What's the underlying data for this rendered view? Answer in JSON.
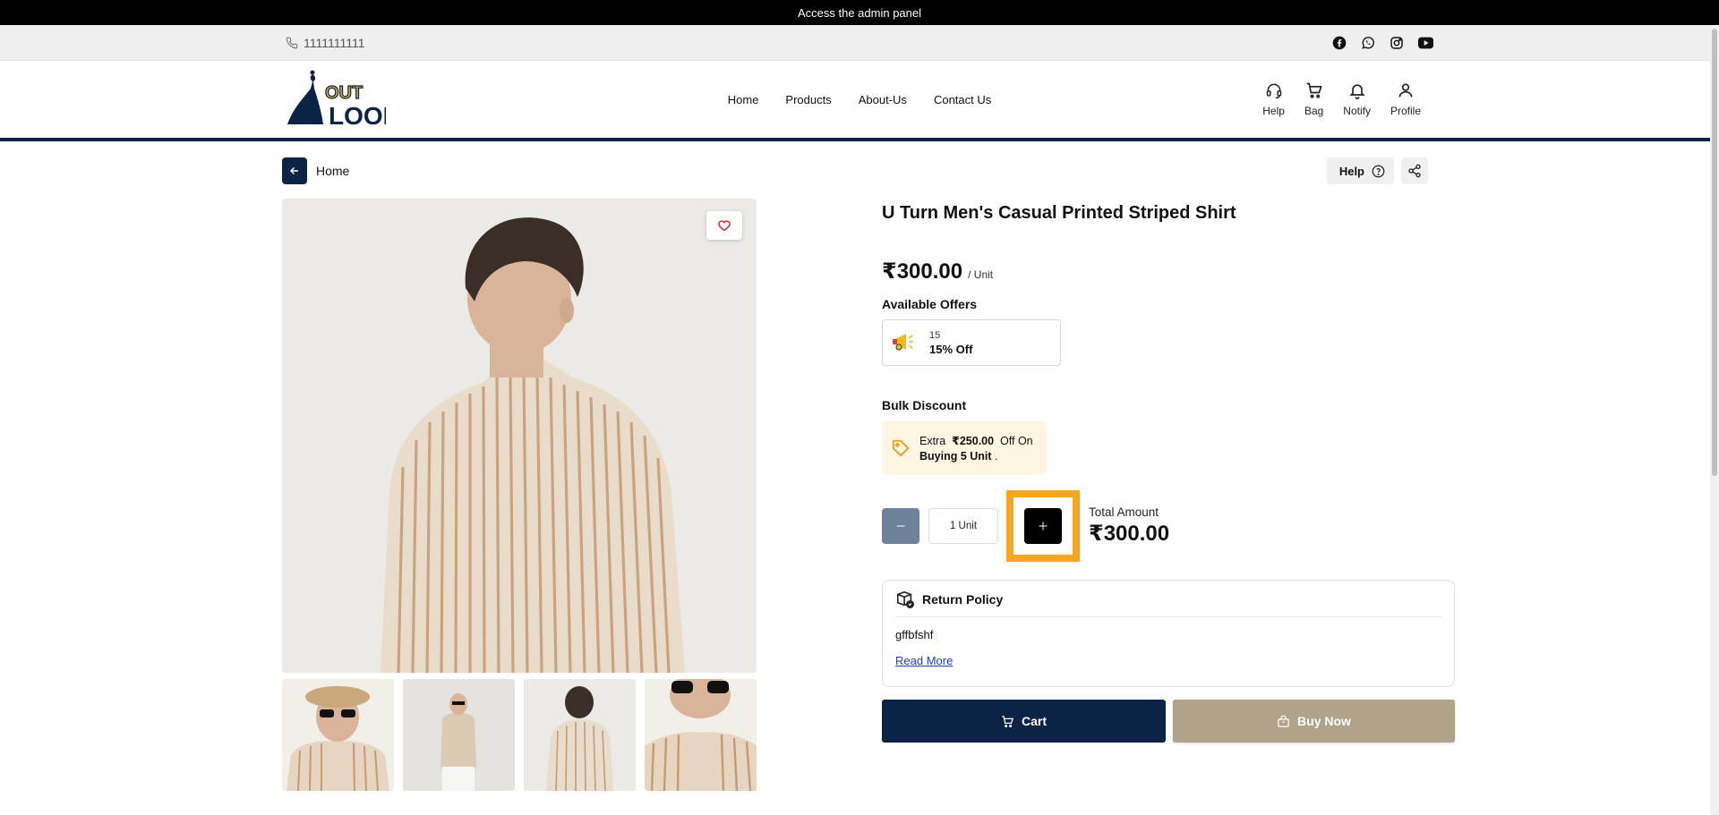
{
  "admin_bar": {
    "text": "Access the admin panel"
  },
  "contact": {
    "phone": "1111111111",
    "socials": [
      "facebook-icon",
      "whatsapp-icon",
      "instagram-icon",
      "youtube-icon"
    ]
  },
  "nav": {
    "links": [
      "Home",
      "Products",
      "About-Us",
      "Contact Us"
    ],
    "icons": [
      {
        "label": "Help",
        "icon": "headset-icon"
      },
      {
        "label": "Bag",
        "icon": "cart-icon"
      },
      {
        "label": "Notify",
        "icon": "bell-icon"
      },
      {
        "label": "Profile",
        "icon": "user-icon"
      }
    ]
  },
  "breadcrumb": {
    "label": "Home"
  },
  "toolbar": {
    "help_label": "Help"
  },
  "product": {
    "title": "U Turn Men's Casual Printed Striped Shirt",
    "price": "₹300.00",
    "unit": "/ Unit",
    "offers_label": "Available Offers",
    "offer": {
      "code": "15",
      "text": "15% Off"
    },
    "bulk_label": "Bulk Discount",
    "bulk": {
      "prefix": "Extra",
      "amount": "₹250.00",
      "suffix": "Off On",
      "condition": "Buying 5 Unit",
      "dot": "."
    },
    "quantity": "1 Unit",
    "total_label": "Total Amount",
    "total": "₹300.00",
    "policy": {
      "title": "Return Policy",
      "body": "gffbfshf",
      "read_more": "Read More"
    },
    "actions": {
      "cart": "Cart",
      "buy": "Buy Now"
    }
  },
  "colors": {
    "navy": "#0b2344",
    "buy": "#b1a28a",
    "highlight": "#f5a623"
  }
}
